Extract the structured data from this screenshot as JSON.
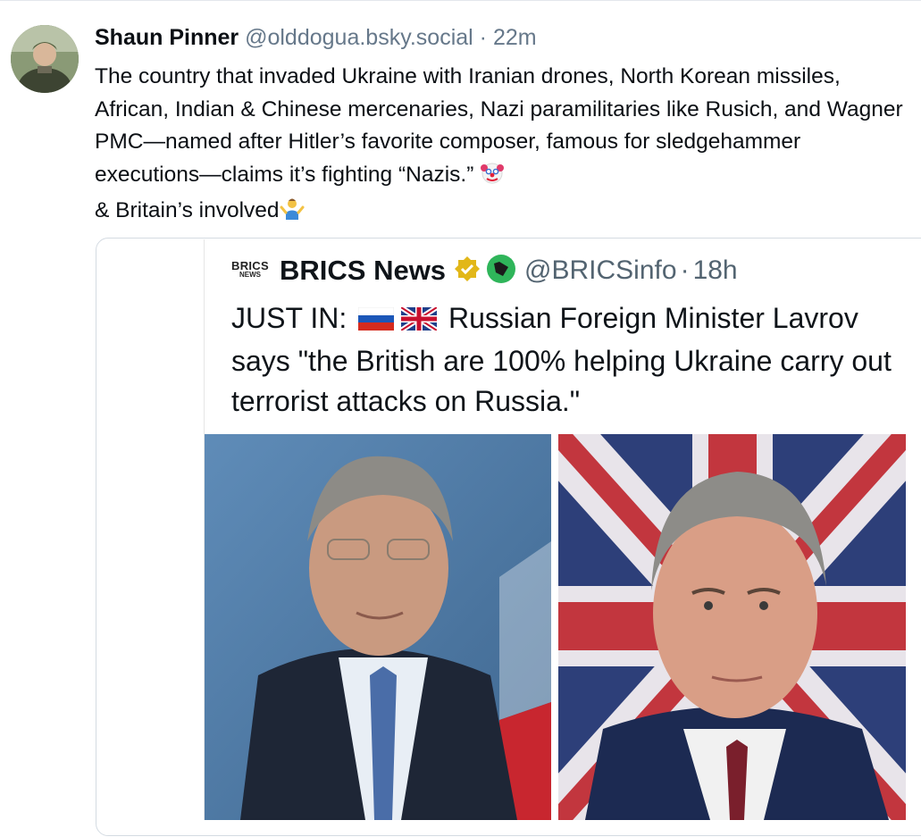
{
  "post": {
    "author": "Shaun Pinner",
    "handle": "@olddogua.bsky.social",
    "separator": "·",
    "time": "22m",
    "text_main": "The country that invaded Ukraine with Iranian drones, North Korean missiles, African, Indian & Chinese mercenaries, Nazi paramilitaries like Rusich, and Wagner PMC—named after Hitler’s favorite composer, famous for sledgehammer executions—claims it’s fighting “Nazis.”",
    "text_end": "& Britain’s involved",
    "emojis": [
      "clown-face",
      "person-shrugging"
    ]
  },
  "quoted": {
    "logo_line1": "BRICS",
    "logo_line2": "NEWS",
    "name": "BRICS News",
    "handle": "@BRICSinfo",
    "separator": "·",
    "time": "18h",
    "text_prefix": "JUST IN:",
    "text_body": "Russian Foreign Minister Lavrov says \"the British are 100% helping Ukraine carry out terrorist attacks on Russia.\"",
    "flags": [
      "russia-flag",
      "uk-flag"
    ]
  },
  "colors": {
    "text": "#0b0f14",
    "muted": "#66788a",
    "border": "#d4dbe2",
    "verified_gold": "#e2b719",
    "badge_green": "#2fb55a"
  }
}
